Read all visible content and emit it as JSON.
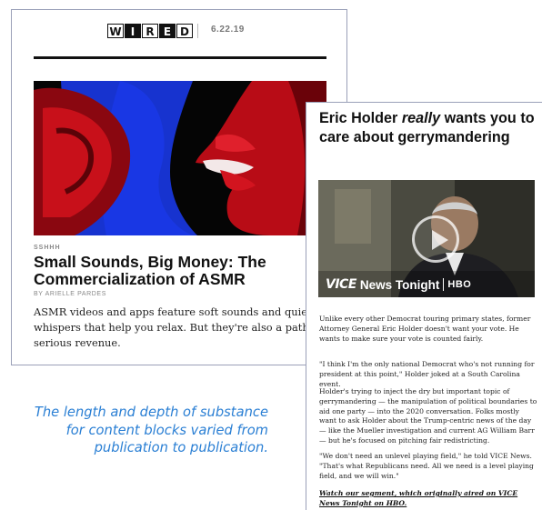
{
  "wired": {
    "logo_letters": [
      "W",
      "I",
      "R",
      "E",
      "D"
    ],
    "date": "6.22.19",
    "kicker": "SSHHH",
    "title": "Small Sounds, Big Money: The Commercialization of ASMR",
    "byline": "BY ARIELLE PARDES",
    "body": "ASMR videos and apps feature soft sounds and quiet whispers that help you relax. But they're also a path to serious revenue."
  },
  "vice": {
    "title_before": "Eric Holder ",
    "title_emph": "really",
    "title_after": " wants you to care about gerrymandering",
    "video": {
      "logo": "VICE",
      "show": "News Tonight",
      "network": "HBO"
    },
    "paragraphs": [
      "Unlike every other Democrat touring primary states, former Attorney General Eric Holder doesn't want your vote. He wants to make sure your vote is counted fairly.",
      "\"I think I'm the only national Democrat who's not running for president at this point,\" Holder joked at a South Carolina event.",
      "Holder's trying to inject the dry but important topic of gerrymandering — the manipulation of political boundaries to aid one party — into the 2020 conversation. Folks mostly want to ask Holder about the Trump-centric news of the day — like the Mueller investigation and current AG William Barr — but he's focused on pitching fair redistricting.",
      "\"We don't need an unlevel playing field,\" he told VICE News. \"That's what Republicans need. All we need is a level playing field, and we will win.\""
    ],
    "link": "Watch our segment, which originally aired on VICE News Tonight on HBO."
  },
  "caption": "The length and depth of substance for content blocks varied from publication to publication.",
  "colors": {
    "caption": "#2a7fd4",
    "card_border": "#9aa0b8",
    "image_blue": "#1530d8",
    "image_red": "#c8101a"
  }
}
